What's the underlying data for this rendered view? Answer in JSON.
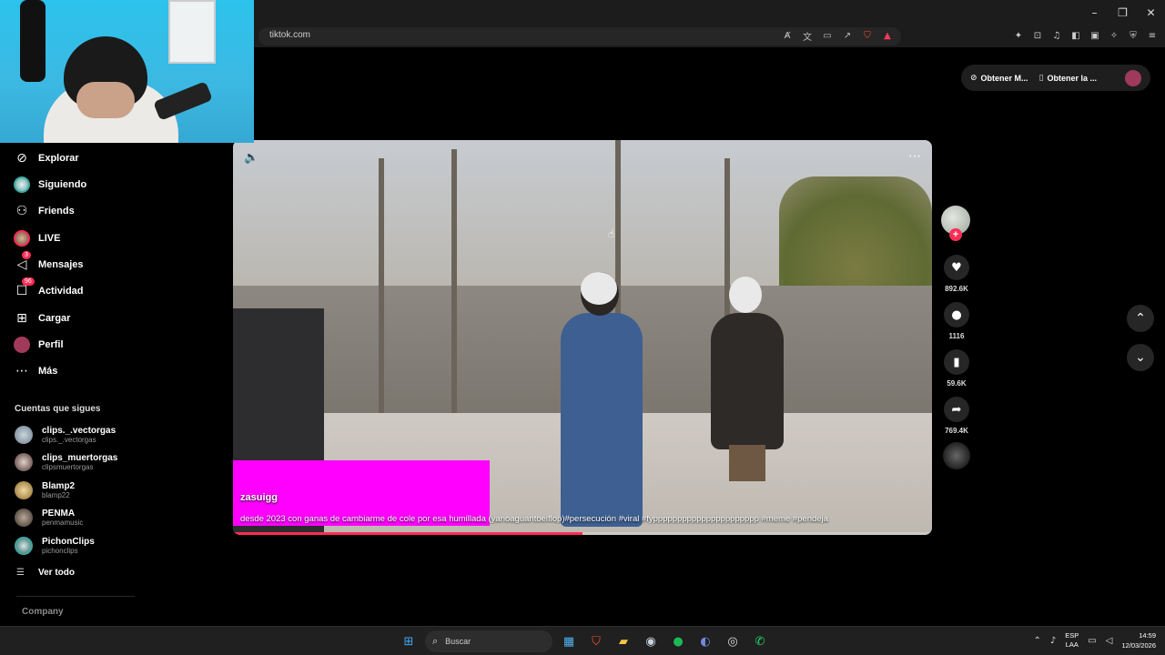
{
  "browser": {
    "url": "tiktok.com",
    "window_controls": {
      "minimize": "–",
      "restore": "❐",
      "close": "✕"
    }
  },
  "sidebar": {
    "nav": [
      {
        "label": "Explorar",
        "icon": "compass-icon"
      },
      {
        "label": "Siguiendo",
        "icon": "following-avatar-icon"
      },
      {
        "label": "Friends",
        "icon": "friends-icon"
      },
      {
        "label": "LIVE",
        "icon": "live-avatar-icon"
      },
      {
        "label": "Mensajes",
        "icon": "paper-plane-icon",
        "badge": "3"
      },
      {
        "label": "Actividad",
        "icon": "message-box-icon",
        "badge": "96"
      },
      {
        "label": "Cargar",
        "icon": "plus-square-icon"
      },
      {
        "label": "Perfil",
        "icon": "profile-avatar-icon"
      },
      {
        "label": "Más",
        "icon": "ellipsis-icon"
      }
    ],
    "following_title": "Cuentas que sigues",
    "following": [
      {
        "name": "clips._.vectorgas",
        "handle": "clips._.vectorgas"
      },
      {
        "name": "clips_muertorgas",
        "handle": "clipsmuertorgas"
      },
      {
        "name": "Blamp2",
        "handle": "blamp22"
      },
      {
        "name": "PENMA",
        "handle": "penmamusic"
      },
      {
        "name": "PichonClips",
        "handle": "pichonclips"
      }
    ],
    "see_all": "Ver todo",
    "company": "Company"
  },
  "top_actions": {
    "get_app_1": "Obtener M...",
    "get_app_2": "Obtener la ..."
  },
  "video": {
    "author": "zasuigg",
    "caption": "desde 2023 con ganas de cambiarme de cole por esa humillada (yanoaguantoelflop)#persecución #viral #fypppppppppppppppppppppp #meme #pendeja",
    "progress": 0.5
  },
  "actions": {
    "likes": "892.6K",
    "comments": "1116",
    "saves": "59.6K",
    "shares": "769.4K"
  },
  "taskbar": {
    "search": "Buscar",
    "lang_1": "ESP",
    "lang_2": "LAA",
    "time": "14:59",
    "date": "12/03/2026"
  },
  "colors": {
    "accent": "#fe2c55",
    "background": "#000000",
    "overlay_magenta": "#ff00ff"
  }
}
